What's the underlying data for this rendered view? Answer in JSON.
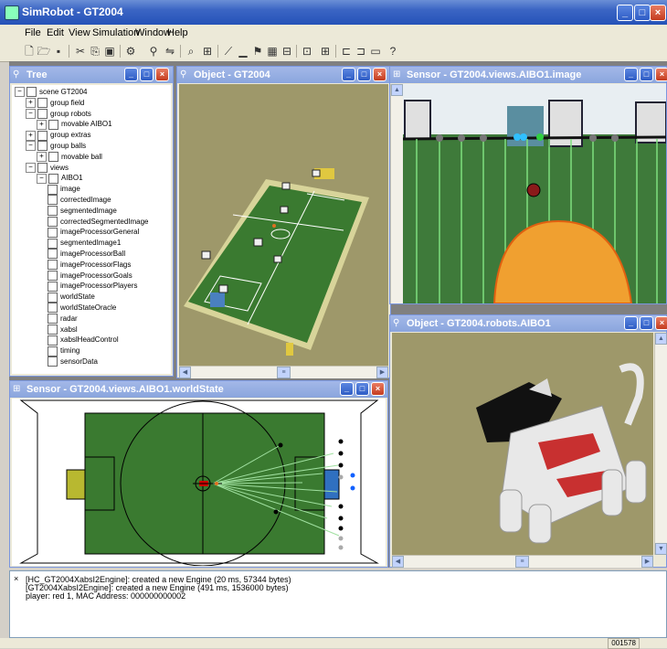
{
  "app": {
    "title": "SimRobot - GT2004"
  },
  "menu": [
    "File",
    "Edit",
    "View",
    "Simulation",
    "Window",
    "Help"
  ],
  "windows": {
    "tree": {
      "title": "Tree"
    },
    "object_field": {
      "title": "Object - GT2004"
    },
    "sensor_image": {
      "title": "Sensor - GT2004.views.AIBO1.image"
    },
    "object_robot": {
      "title": "Object - GT2004.robots.AIBO1"
    },
    "sensor_worldstate": {
      "title": "Sensor - GT2004.views.AIBO1.worldState"
    }
  },
  "tree": {
    "items": [
      {
        "label": "scene GT2004",
        "depth": 0,
        "toggle": "−"
      },
      {
        "label": "group field",
        "depth": 1,
        "toggle": "+"
      },
      {
        "label": "group robots",
        "depth": 1,
        "toggle": "−"
      },
      {
        "label": "movable AIBO1",
        "depth": 2,
        "toggle": "+"
      },
      {
        "label": "group extras",
        "depth": 1,
        "toggle": "+"
      },
      {
        "label": "group balls",
        "depth": 1,
        "toggle": "−"
      },
      {
        "label": "movable ball",
        "depth": 2,
        "toggle": "+"
      },
      {
        "label": "views",
        "depth": 1,
        "toggle": "−"
      },
      {
        "label": "AIBO1",
        "depth": 2,
        "toggle": "−"
      },
      {
        "label": "image",
        "depth": 3,
        "toggle": ""
      },
      {
        "label": "correctedImage",
        "depth": 3,
        "toggle": ""
      },
      {
        "label": "segmentedImage",
        "depth": 3,
        "toggle": ""
      },
      {
        "label": "correctedSegmentedImage",
        "depth": 3,
        "toggle": ""
      },
      {
        "label": "imageProcessorGeneral",
        "depth": 3,
        "toggle": ""
      },
      {
        "label": "segmentedImage1",
        "depth": 3,
        "toggle": ""
      },
      {
        "label": "imageProcessorBall",
        "depth": 3,
        "toggle": ""
      },
      {
        "label": "imageProcessorFlags",
        "depth": 3,
        "toggle": ""
      },
      {
        "label": "imageProcessorGoals",
        "depth": 3,
        "toggle": ""
      },
      {
        "label": "imageProcessorPlayers",
        "depth": 3,
        "toggle": ""
      },
      {
        "label": "worldState",
        "depth": 3,
        "toggle": ""
      },
      {
        "label": "worldStateOracle",
        "depth": 3,
        "toggle": ""
      },
      {
        "label": "radar",
        "depth": 3,
        "toggle": ""
      },
      {
        "label": "xabsl",
        "depth": 3,
        "toggle": ""
      },
      {
        "label": "xabslHeadControl",
        "depth": 3,
        "toggle": ""
      },
      {
        "label": "timing",
        "depth": 3,
        "toggle": ""
      },
      {
        "label": "sensorData",
        "depth": 3,
        "toggle": ""
      }
    ]
  },
  "console": {
    "lines": [
      "[HC_GT2004XabsI2Engine]: created a new Engine (20 ms, 57344 bytes)",
      "[GT2004XabsI2Engine]: created a new Engine (491 ms, 1536000 bytes)",
      "player: red 1, MAC Address: 000000000002"
    ]
  },
  "status": {
    "counter": "001578"
  },
  "colors": {
    "field": "#3a7a30",
    "titlebar": "#2552b8",
    "window_title": "#8aa5dd"
  }
}
